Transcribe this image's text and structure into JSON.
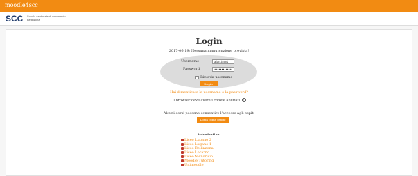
{
  "header": {
    "brand": "moodle4scc",
    "school_line1": "Scuola cantonale di commercio",
    "school_line2": "Bellinzona"
  },
  "colors": {
    "accent": "#f28b12",
    "oval": "#dcdcdc"
  },
  "login": {
    "title": "Login",
    "maintenance_notice": "2017-06-19: Nessuna manutenzione prevista!",
    "username_label": "Username",
    "username_value": "alan.tsent",
    "password_label": "Password",
    "password_value": "••••••••••••",
    "remember_label": "Ricorda username",
    "remember_checked": false,
    "login_button": "Login",
    "forgot_link": "Hai dimenticato la username o la password?",
    "cookies_notice": "Il browser deve avere i cookie abilitati",
    "help_icon": "question-circle-icon",
    "guest_notice": "Alcuni corsi possono consentire l'accesso agli ospiti",
    "guest_button": "Login come ospite"
  },
  "auth": {
    "heading": "Autenticati su:",
    "providers": [
      "Liceo Lugano 2",
      "Liceo Lugano 1",
      "Liceo Bellinzona",
      "Liceo Locarno",
      "Liceo Mendrisio",
      "Moodle Tutoring",
      "Unimoodle"
    ]
  }
}
